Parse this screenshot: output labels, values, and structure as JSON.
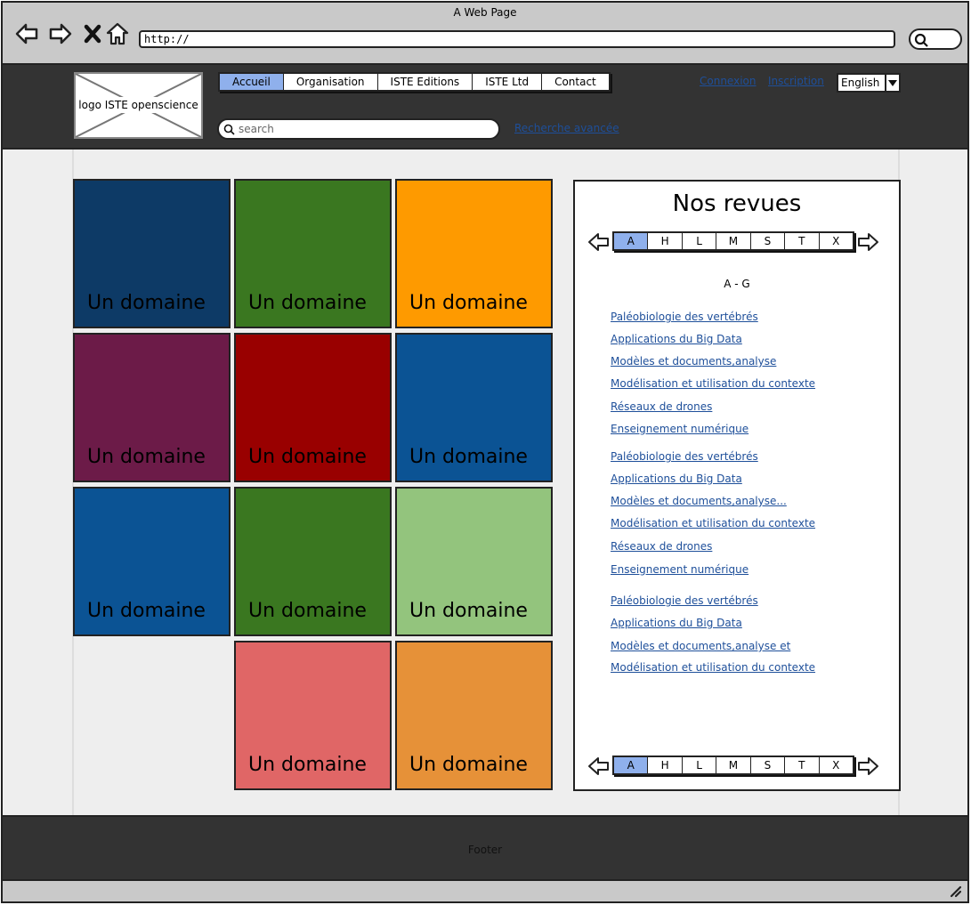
{
  "browser": {
    "title": "A Web Page",
    "url": "http://"
  },
  "header": {
    "logo_label": "logo ISTE openscience",
    "menu": [
      {
        "label": "Accueil",
        "active": true
      },
      {
        "label": "Organisation",
        "active": false
      },
      {
        "label": "ISTE Editions",
        "active": false
      },
      {
        "label": "ISTE Ltd",
        "active": false
      },
      {
        "label": "Contact",
        "active": false
      }
    ],
    "login_label": "Connexion",
    "signup_label": "Inscription",
    "language": "English",
    "search_placeholder": "search",
    "advanced_search_label": "Recherche avancée"
  },
  "tiles": [
    {
      "label": "Un domaine",
      "color": "#0d3a66"
    },
    {
      "label": "Un domaine",
      "color": "#3a7720"
    },
    {
      "label": "Un domaine",
      "color": "#fe9a00"
    },
    {
      "label": "Un domaine",
      "color": "#6c1b48"
    },
    {
      "label": "Un domaine",
      "color": "#990000"
    },
    {
      "label": "Un domaine",
      "color": "#0b5394"
    },
    {
      "label": "Un domaine",
      "color": "#0b5394"
    },
    {
      "label": "Un domaine",
      "color": "#3a7720"
    },
    {
      "label": "Un domaine",
      "color": "#93c47d"
    },
    {
      "label": "Un domaine",
      "color": "#e06666"
    },
    {
      "label": "Un domaine",
      "color": "#e69138"
    }
  ],
  "journals_panel": {
    "title": "Nos revues",
    "alphabet": [
      "A",
      "H",
      "L",
      "M",
      "S",
      "T",
      "X"
    ],
    "active_letter": "A",
    "range_label": "A - G",
    "groups": [
      [
        "Paléobiologie des vertébrés ",
        "Applications du Big Data ",
        "Modèles et documents,analyse",
        "Modélisation et utilisation du contexte ",
        "Réseaux de drones ",
        "Enseignement numérique"
      ],
      [
        "Paléobiologie des vertébrés ",
        "Applications du Big Data ",
        "Modèles et documents,analyse...",
        "Modélisation et utilisation du contexte ",
        "Réseaux de drones ",
        "Enseignement numérique"
      ],
      [
        "Paléobiologie des vertébrés ",
        "Applications du Big Data ",
        "Modèles et documents,analyse et",
        "Modélisation et utilisation du contexte "
      ]
    ]
  },
  "footer": {
    "label": "Footer"
  },
  "colors": {
    "header_bg": "#333333",
    "accent": "#8fb0ec",
    "link": "#1e4f9a"
  }
}
